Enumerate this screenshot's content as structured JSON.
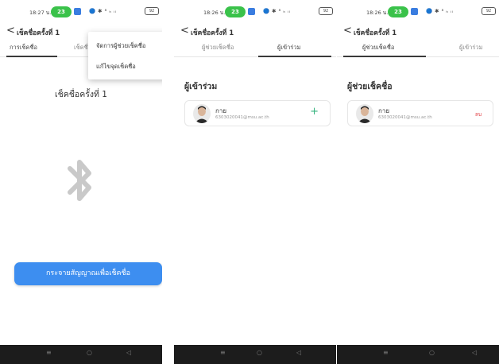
{
  "status": {
    "time1": "18:27 น.",
    "time2": "18:26 น.",
    "time3": "18:26 น.",
    "pill": "23",
    "icons": "🔵 ✱ ⁸ ₕ ᵢₗ",
    "battery": "92"
  },
  "header": {
    "back_label": "<",
    "title": "เช็คชื่อครั้งที่ 1"
  },
  "tabs": {
    "checkin": "การเช็คชื่อ",
    "checkin_truncated": "เช็คชื่",
    "assistants": "ผู้ช่วยเช็คชื่อ",
    "participants": "ผู้เข้าร่วม"
  },
  "menu": {
    "manage_assistants": "จัดการผู้ช่วยเช็คชื่อ",
    "edit_checkin": "แก้ไขจุดเช็คชื่อ"
  },
  "session": {
    "title": "เช็คชื่อครั้งที่ 1",
    "broadcast_label": "กระจายสัญญาณเพื่อเช็คชื่อ"
  },
  "participants": {
    "heading": "ผู้เข้าร่วม"
  },
  "assistants_section": {
    "heading": "ผู้ช่วยเช็คชื่อ"
  },
  "user": {
    "name": "กาย",
    "email": "6303020041@msu.ac.th"
  },
  "actions": {
    "add": "+",
    "remove": "ลบ"
  },
  "navbar": {
    "menu": "≡",
    "home": "○",
    "back": "◁"
  },
  "colors": {
    "accent": "#3d8ef0",
    "add_green": "#36b37e",
    "delete_red": "#e0373c",
    "navbar": "#1c1c1c"
  }
}
